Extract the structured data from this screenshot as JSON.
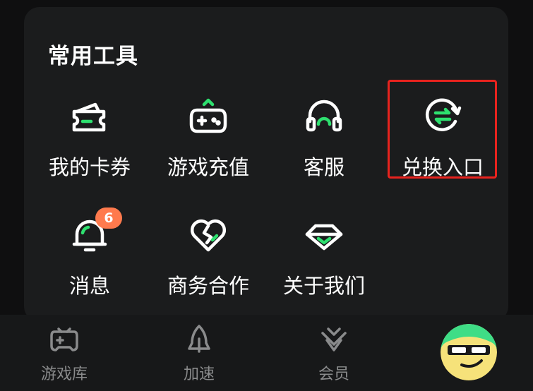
{
  "section": {
    "title": "常用工具"
  },
  "tools": [
    {
      "label": "我的卡券",
      "icon": "coupon-ticket-icon"
    },
    {
      "label": "游戏充值",
      "icon": "gamepad-recharge-icon"
    },
    {
      "label": "客服",
      "icon": "headset-icon"
    },
    {
      "label": "兑换入口",
      "icon": "exchange-arrows-icon",
      "highlighted": true
    },
    {
      "label": "消息",
      "icon": "bell-icon",
      "badge": "6"
    },
    {
      "label": "商务合作",
      "icon": "heart-handshake-icon"
    },
    {
      "label": "关于我们",
      "icon": "chevron-diamond-icon"
    }
  ],
  "tabbar": [
    {
      "label": "游戏库",
      "icon": "gamepad-icon"
    },
    {
      "label": "加速",
      "icon": "rocket-icon"
    },
    {
      "label": "会员",
      "icon": "vip-diamond-icon"
    }
  ],
  "colors": {
    "accent": "#2ee06f",
    "badge": "#ff7a4d",
    "highlight_border": "#e8231e",
    "card_bg": "#1b1c1d",
    "page_bg": "#0f0f10"
  }
}
